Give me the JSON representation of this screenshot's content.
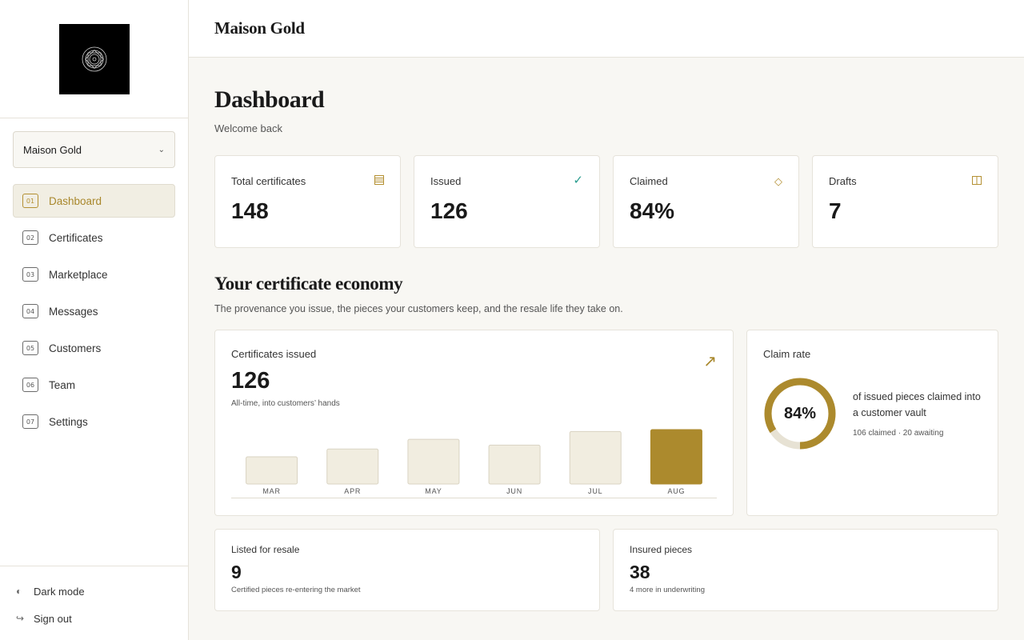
{
  "sidebar": {
    "org": "Maison Gold",
    "nav": [
      {
        "num": "01",
        "label": "Dashboard",
        "active": true
      },
      {
        "num": "02",
        "label": "Certificates"
      },
      {
        "num": "03",
        "label": "Marketplace"
      },
      {
        "num": "04",
        "label": "Messages"
      },
      {
        "num": "05",
        "label": "Customers"
      },
      {
        "num": "06",
        "label": "Team"
      },
      {
        "num": "07",
        "label": "Settings"
      }
    ],
    "dark_mode": "Dark mode",
    "sign_out": "Sign out"
  },
  "topbar": {
    "brand": "Maison Gold"
  },
  "page": {
    "title": "Dashboard",
    "subtitle": "Welcome back"
  },
  "stats": [
    {
      "label": "Total certificates",
      "value": "148",
      "icon": "ledger-icon"
    },
    {
      "label": "Issued",
      "value": "126",
      "icon": "check-icon"
    },
    {
      "label": "Claimed",
      "value": "84%",
      "icon": "diamond-icon"
    },
    {
      "label": "Drafts",
      "value": "7",
      "icon": "book-icon"
    }
  ],
  "section": {
    "title": "Your certificate economy",
    "subtitle": "The provenance you issue, the pieces your customers keep, and the resale life they take on."
  },
  "issued": {
    "label": "Certificates issued",
    "value": "126",
    "note": "All-time, into customers’ hands"
  },
  "claim": {
    "label": "Claim rate",
    "value": "84%",
    "fraction": 0.84,
    "desc": "of issued pieces claimed into a customer vault",
    "foot": "106 claimed · 20 awaiting"
  },
  "resale": {
    "label": "Listed for resale",
    "value": "9",
    "note": "Certified pieces re-entering the market"
  },
  "insured": {
    "label": "Insured pieces",
    "value": "38",
    "note": "4 more in underwriting"
  },
  "colors": {
    "accent": "#ac8a2d",
    "bar": "#f1ede0",
    "bar_border": "#d9d3c2",
    "check": "#2a9d8f"
  },
  "chart_data": {
    "type": "bar",
    "categories": [
      "MAR",
      "APR",
      "MAY",
      "JUN",
      "JUL",
      "AUG"
    ],
    "values": [
      14,
      18,
      23,
      20,
      27,
      28
    ],
    "highlight": "AUG",
    "title": "",
    "xlabel": "",
    "ylabel": "",
    "ylim": [
      0,
      28
    ],
    "grid": false
  }
}
